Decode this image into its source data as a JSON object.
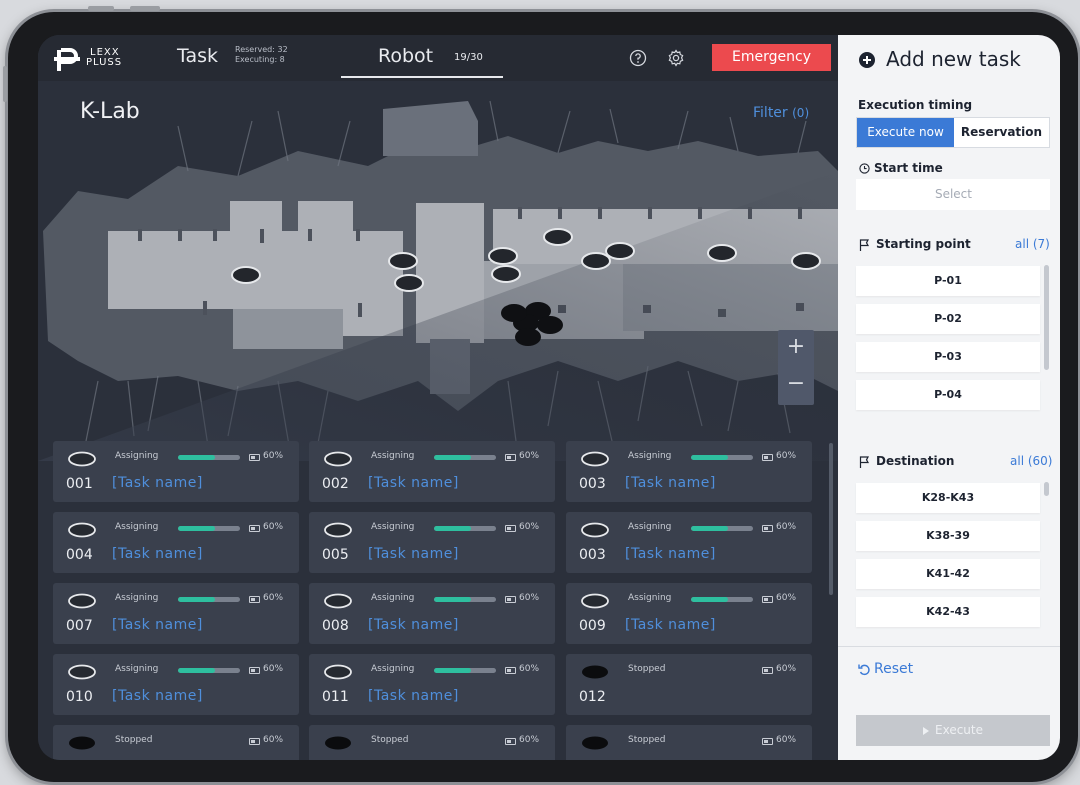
{
  "brand": {
    "logo_text_1": "LEXX",
    "logo_text_2": "PLUSS"
  },
  "nav": {
    "task_label": "Task",
    "reserved": "Reserved: 32",
    "executing": "Executing: 8",
    "robot_label": "Robot",
    "robot_count": "19/30",
    "help_icon": "help-circle-icon",
    "settings_icon": "gear-icon",
    "emergency_label": "Emergency"
  },
  "map": {
    "site_name": "K-Lab",
    "filter_label": "Filter",
    "filter_count": "(0)",
    "zoom_in": "+",
    "zoom_out": "−"
  },
  "robots": [
    {
      "id": "001",
      "status": "Assigning",
      "progress": 0.6,
      "battery": "60%",
      "task": "[Task name]",
      "state": "active"
    },
    {
      "id": "002",
      "status": "Assigning",
      "progress": 0.6,
      "battery": "60%",
      "task": "[Task name]",
      "state": "active"
    },
    {
      "id": "003",
      "status": "Assigning",
      "progress": 0.6,
      "battery": "60%",
      "task": "[Task name]",
      "state": "active"
    },
    {
      "id": "004",
      "status": "Assigning",
      "progress": 0.6,
      "battery": "60%",
      "task": "[Task name]",
      "state": "active"
    },
    {
      "id": "005",
      "status": "Assigning",
      "progress": 0.6,
      "battery": "60%",
      "task": "[Task name]",
      "state": "active"
    },
    {
      "id": "003",
      "status": "Assigning",
      "progress": 0.6,
      "battery": "60%",
      "task": "[Task name]",
      "state": "active"
    },
    {
      "id": "007",
      "status": "Assigning",
      "progress": 0.6,
      "battery": "60%",
      "task": "[Task name]",
      "state": "active"
    },
    {
      "id": "008",
      "status": "Assigning",
      "progress": 0.6,
      "battery": "60%",
      "task": "[Task name]",
      "state": "active"
    },
    {
      "id": "009",
      "status": "Assigning",
      "progress": 0.6,
      "battery": "60%",
      "task": "[Task name]",
      "state": "active"
    },
    {
      "id": "010",
      "status": "Assigning",
      "progress": 0.6,
      "battery": "60%",
      "task": "[Task name]",
      "state": "active"
    },
    {
      "id": "011",
      "status": "Assigning",
      "progress": 0.6,
      "battery": "60%",
      "task": "[Task name]",
      "state": "active"
    },
    {
      "id": "012",
      "status": "Stopped",
      "progress": null,
      "battery": "60%",
      "task": "",
      "state": "stopped"
    },
    {
      "id": "",
      "status": "Stopped",
      "progress": null,
      "battery": "60%",
      "task": "",
      "state": "stopped"
    },
    {
      "id": "",
      "status": "Stopped",
      "progress": null,
      "battery": "60%",
      "task": "",
      "state": "stopped"
    },
    {
      "id": "",
      "status": "Stopped",
      "progress": null,
      "battery": "60%",
      "task": "",
      "state": "stopped"
    }
  ],
  "panel": {
    "title": "Add new task",
    "add_icon": "plus-circle-icon",
    "execution_timing_label": "Execution timing",
    "execute_now_label": "Execute now",
    "reservation_label": "Reservation",
    "start_time_label": "Start time",
    "start_time_placeholder": "Select",
    "starting_point_label": "Starting point",
    "starting_point_all": "all (7)",
    "starting_points": [
      "P-01",
      "P-02",
      "P-03",
      "P-04"
    ],
    "destination_label": "Destination",
    "destination_all": "all (60)",
    "destinations": [
      "K28-K43",
      "K38-39",
      "K41-42",
      "K42-43"
    ],
    "reset_label": "Reset",
    "execute_label": "Execute"
  },
  "colors": {
    "accent_blue": "#3b7ad6",
    "emergency_red": "#ec4a4e",
    "progress_teal": "#2ebf9f",
    "dark_bg": "#2b303b",
    "card_bg": "#3a404d"
  }
}
